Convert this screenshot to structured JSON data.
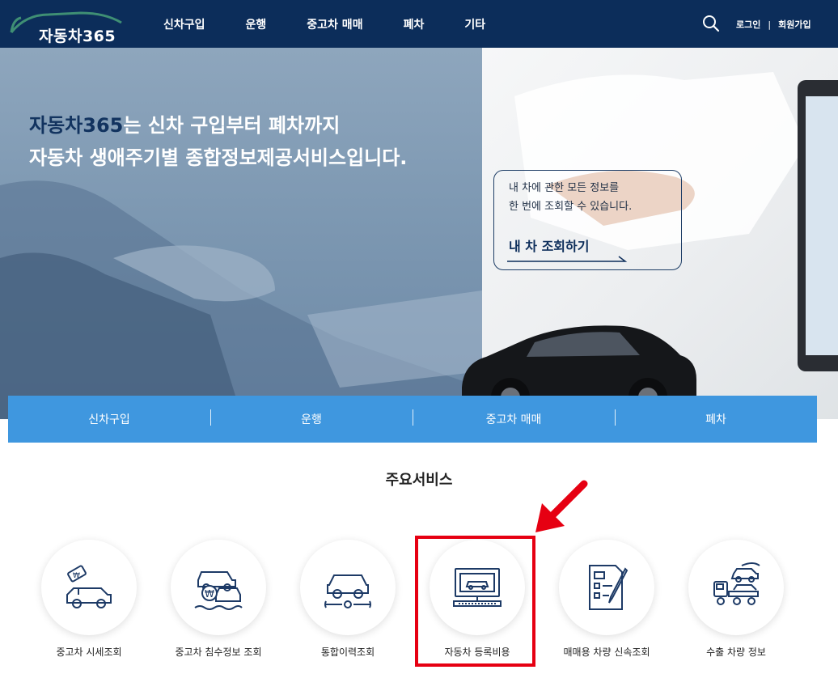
{
  "header": {
    "logo_text": "자동차365",
    "nav": [
      "신차구입",
      "운행",
      "중고차 매매",
      "폐차",
      "기타"
    ],
    "login": "로그인",
    "separator": "|",
    "signup": "회원가입"
  },
  "hero": {
    "brand": "자동차365",
    "title_line1_rest": "는 신차 구입부터 폐차까지",
    "title_line2": "자동차 생애주기별 종합정보제공서비스입니다.",
    "promo_line1": "내 차에 관한 모든 정보를",
    "promo_line2": "한 번에 조회할 수 있습니다.",
    "promo_cta": "내 차 조회하기"
  },
  "subnav": [
    "신차구입",
    "운행",
    "중고차 매매",
    "폐차"
  ],
  "services": {
    "title": "주요서비스",
    "items": [
      {
        "label": "중고차 시세조회",
        "icon": "car-price-icon"
      },
      {
        "label": "중고차 침수정보 조회",
        "icon": "flooded-car-icon"
      },
      {
        "label": "통합이력조회",
        "icon": "repair-history-icon"
      },
      {
        "label": "자동차 등록비용",
        "icon": "registration-cost-icon"
      },
      {
        "label": "매매용 차량 신속조회",
        "icon": "checklist-icon"
      },
      {
        "label": "수출 차량 정보",
        "icon": "export-truck-icon"
      }
    ]
  },
  "colors": {
    "header_bg": "#0c2d5a",
    "subnav_bg": "#3f97df",
    "highlight": "#e60012",
    "icon_stroke": "#1d3a66"
  }
}
